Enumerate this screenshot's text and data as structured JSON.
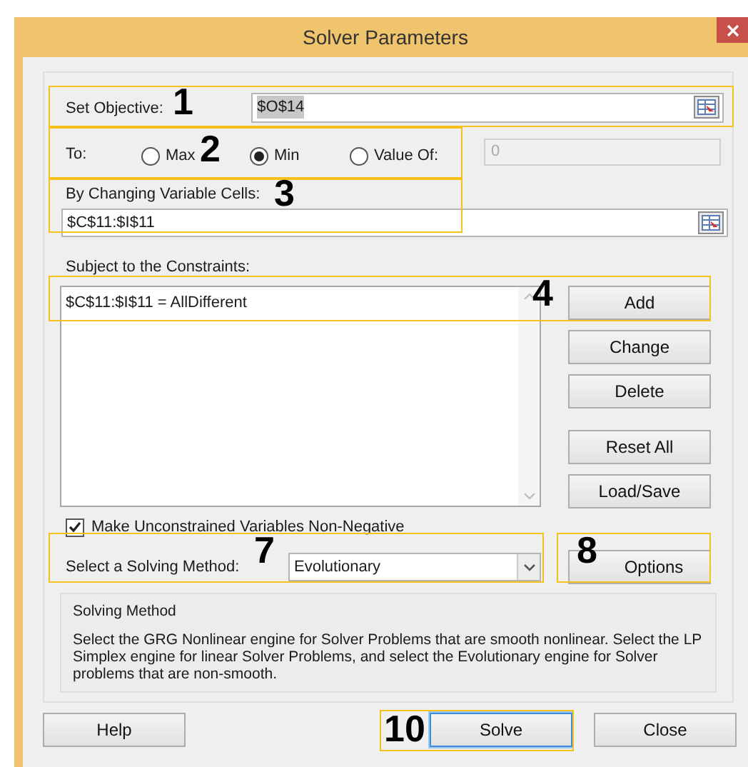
{
  "window": {
    "title": "Solver Parameters"
  },
  "objective": {
    "label": "Set Objective:",
    "value": "$O$14"
  },
  "to": {
    "label": "To:",
    "options": [
      {
        "label": "Max",
        "selected": false
      },
      {
        "label": "Min",
        "selected": true
      },
      {
        "label": "Value Of:",
        "selected": false
      }
    ],
    "value_of": {
      "value": "0",
      "disabled": true
    }
  },
  "changing_cells": {
    "label": "By Changing Variable Cells:",
    "value": "$C$11:$I$11"
  },
  "constraints": {
    "label": "Subject to the Constraints:",
    "items": [
      "$C$11:$I$11 = AllDifferent"
    ]
  },
  "constraint_buttons": [
    "Add",
    "Change",
    "Delete",
    "Reset All",
    "Load/Save"
  ],
  "non_negative": {
    "label": "Make Unconstrained Variables Non-Negative",
    "checked": true
  },
  "method": {
    "label": "Select a Solving Method:",
    "value": "Evolutionary"
  },
  "options_button": "Options",
  "description": {
    "title": "Solving Method",
    "text": "Select the GRG Nonlinear engine for Solver Problems that are smooth nonlinear. Select the LP Simplex engine for linear Solver Problems, and select the Evolutionary engine for Solver problems that are non-smooth."
  },
  "footer_buttons": [
    {
      "label": "Help",
      "default": false
    },
    {
      "label": "Solve",
      "default": true
    },
    {
      "label": "Close",
      "default": false
    }
  ],
  "annotations": [
    "1",
    "2",
    "3",
    "4",
    "7",
    "8",
    "10"
  ]
}
